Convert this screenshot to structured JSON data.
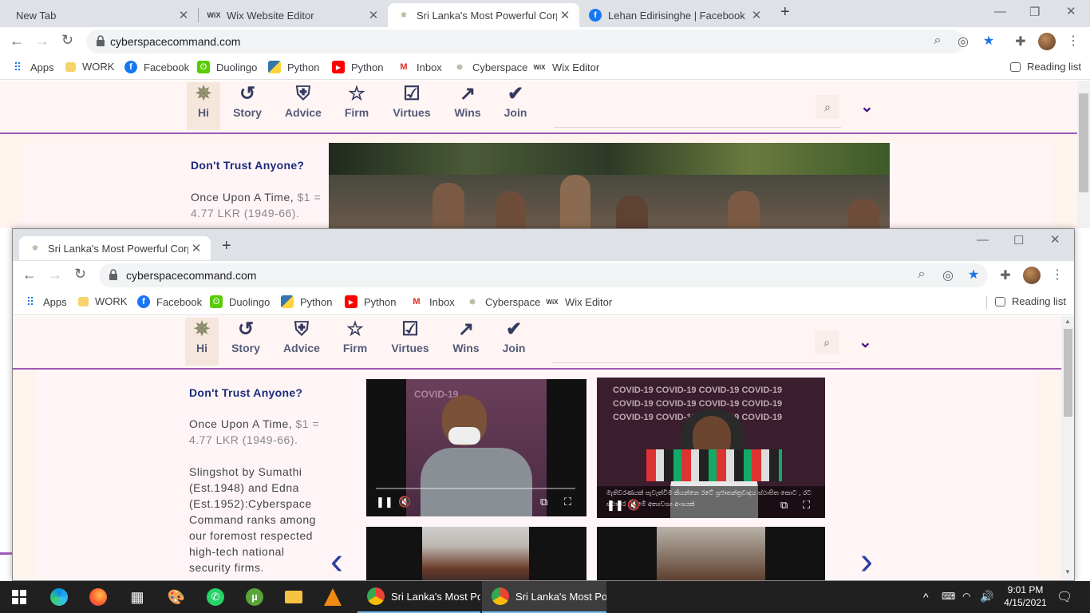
{
  "back_window": {
    "tabs": [
      {
        "title": "New Tab"
      },
      {
        "title": "Wix Website Editor"
      },
      {
        "title": "Sri Lanka's Most Powerful Corpo"
      },
      {
        "title": "Lehan Edirisinghe | Facebook"
      }
    ],
    "url": "cyberspacecommand.com"
  },
  "front_window": {
    "tabs": [
      {
        "title": "Sri Lanka's Most Powerful Corpo"
      }
    ],
    "url": "cyberspacecommand.com"
  },
  "bookmarks": [
    {
      "label": "Apps",
      "icon": "apps-grid-icon"
    },
    {
      "label": "WORK",
      "icon": "folder-icon"
    },
    {
      "label": "Facebook",
      "icon": "facebook-icon"
    },
    {
      "label": "Duolingo",
      "icon": "duolingo-icon"
    },
    {
      "label": "Python",
      "icon": "python-icon"
    },
    {
      "label": "Python",
      "icon": "youtube-icon"
    },
    {
      "label": "Inbox",
      "icon": "gmail-icon"
    },
    {
      "label": "Cyberspace",
      "icon": "cyberspace-star-icon"
    },
    {
      "label": "Wix Editor",
      "icon": "wix-icon"
    }
  ],
  "reading_list": "Reading list",
  "site": {
    "nav": [
      {
        "label": "Hi",
        "icon": "star-badge-icon"
      },
      {
        "label": "Story",
        "icon": "history-icon"
      },
      {
        "label": "Advice",
        "icon": "shield-icon"
      },
      {
        "label": "Firm",
        "icon": "star-icon"
      },
      {
        "label": "Virtues",
        "icon": "checklist-icon"
      },
      {
        "label": "Wins",
        "icon": "trending-up-icon"
      },
      {
        "label": "Join",
        "icon": "user-check-icon"
      }
    ],
    "heading": "Don't Trust Anyone?",
    "p1_a": "Once Upon A Time,",
    "p1_b": " $1 = 4.77 LKR (1949-66).",
    "p2": "Slingshot by Sumathi (Est.1948) and Edna (Est.1952):Cyberspace Command ranks among our foremost respected high-tech national security firms.",
    "video1_bg": "COVID-19",
    "video2_bg": "COVID-19",
    "video2_caption": "මැතිවරණයක් පැවැත්වීම කියන්නෙ රටේ ප්‍රජාතන්ත්‍රවාදය ස්ථාපිත කොට , රට ස්ථාවර කිරීමේ අත්‍යවශ්‍ය අංශයක්"
  },
  "taskbar": {
    "apps": [
      {
        "label": "Sri Lanka's Most Po..."
      },
      {
        "label": "Sri Lanka's Most Po..."
      }
    ],
    "time": "9:01 PM",
    "date": "4/15/2021"
  },
  "colors": {
    "accent_purple": "#9b59b6",
    "nav_text": "#555a78",
    "heading_blue": "#1c2a7a"
  }
}
